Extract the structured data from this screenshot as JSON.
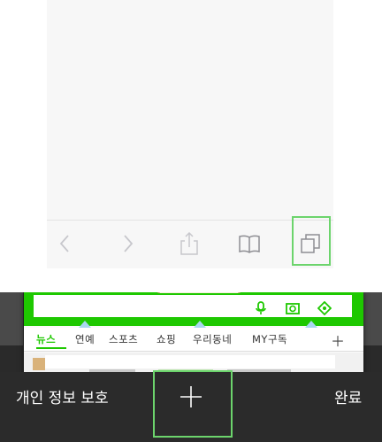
{
  "colors": {
    "highlight": "#6cd46c",
    "ios_tint_disabled": "#c7c7cc",
    "ios_tint": "#9a9a9a",
    "naver_green": "#1ec800"
  },
  "safari_toolbar": {
    "buttons": [
      {
        "name": "back",
        "icon": "chevron-left-icon",
        "enabled": false
      },
      {
        "name": "forward",
        "icon": "chevron-right-icon",
        "enabled": false
      },
      {
        "name": "share",
        "icon": "share-icon",
        "enabled": false
      },
      {
        "name": "bookmarks",
        "icon": "book-icon",
        "enabled": true
      },
      {
        "name": "tabs",
        "icon": "tabs-icon",
        "enabled": true,
        "highlighted": true
      }
    ]
  },
  "tab_card": {
    "menu_items": [
      "뉴스",
      "연예",
      "스포츠",
      "쇼핑",
      "우리동네",
      "MY구독"
    ],
    "active_menu": "뉴스",
    "header_icons": [
      "microphone-icon",
      "camera-search-icon",
      "location-icon"
    ]
  },
  "tab_switcher_bar": {
    "private_label": "개인 정보 보호",
    "new_tab_icon": "plus-icon",
    "done_label": "완료"
  }
}
